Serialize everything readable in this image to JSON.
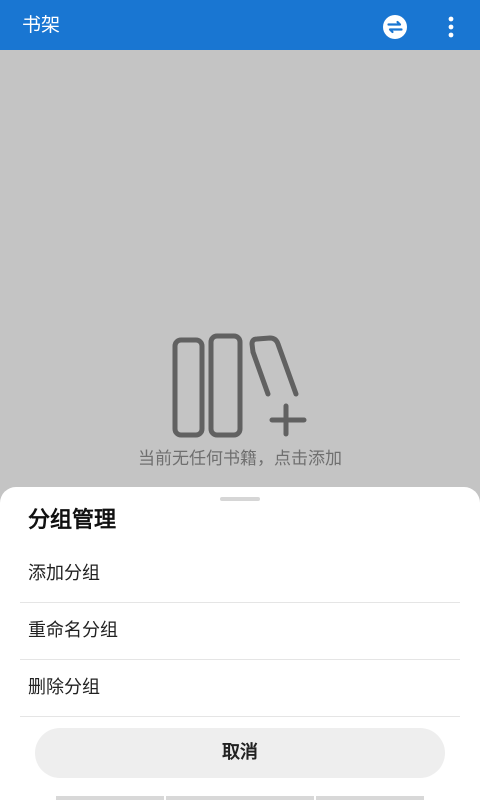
{
  "appbar": {
    "title": "书架",
    "sync_icon": "sync-icon",
    "more_icon": "more-vertical-icon",
    "background": "#1976d2"
  },
  "empty_state": {
    "icon": "bookshelf-add-icon",
    "text": "当前无任何书籍，点击添加"
  },
  "sheet": {
    "title": "分组管理",
    "items": [
      {
        "label": "添加分组"
      },
      {
        "label": "重命名分组"
      },
      {
        "label": "删除分组"
      }
    ],
    "cancel_label": "取消"
  }
}
